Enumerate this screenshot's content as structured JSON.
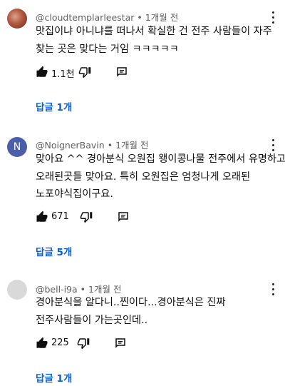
{
  "comments": [
    {
      "author": "@cloudtemplarleestar",
      "time": "1개월 전",
      "lines": [
        "맛집이냐 아니냐를 떠나서 확실한 건 전주 사람들이 자주",
        "찾는 곳은 맞다는 거임 ㅋㅋㅋㅋㅋ"
      ],
      "likes": "1.1천",
      "replies": "답글 1개"
    },
    {
      "author": "@NoignerBavin",
      "avatar_letter": "N",
      "time": "1개월 전",
      "lines": [
        "맞아요 ^^ 경아분식 오원집 왱이콩나물 전주에서 유명하고",
        "오래된곳들 맞아요. 특히 오원집은  엄청나게 오래된",
        "노포야식집이구요."
      ],
      "likes": "671",
      "replies": "답글 5개"
    },
    {
      "author": "@bell-i9a",
      "time": "1개월 전",
      "lines": [
        "경아분식을 알다니..찐이다...경아분식은 진짜",
        "전주사람들이 가는곳인데.."
      ],
      "likes": "225",
      "replies": "답글 1개"
    }
  ],
  "separator": "•",
  "colors": {
    "link": "#065fd4",
    "meta": "#606060",
    "text": "#0f0f0f"
  }
}
